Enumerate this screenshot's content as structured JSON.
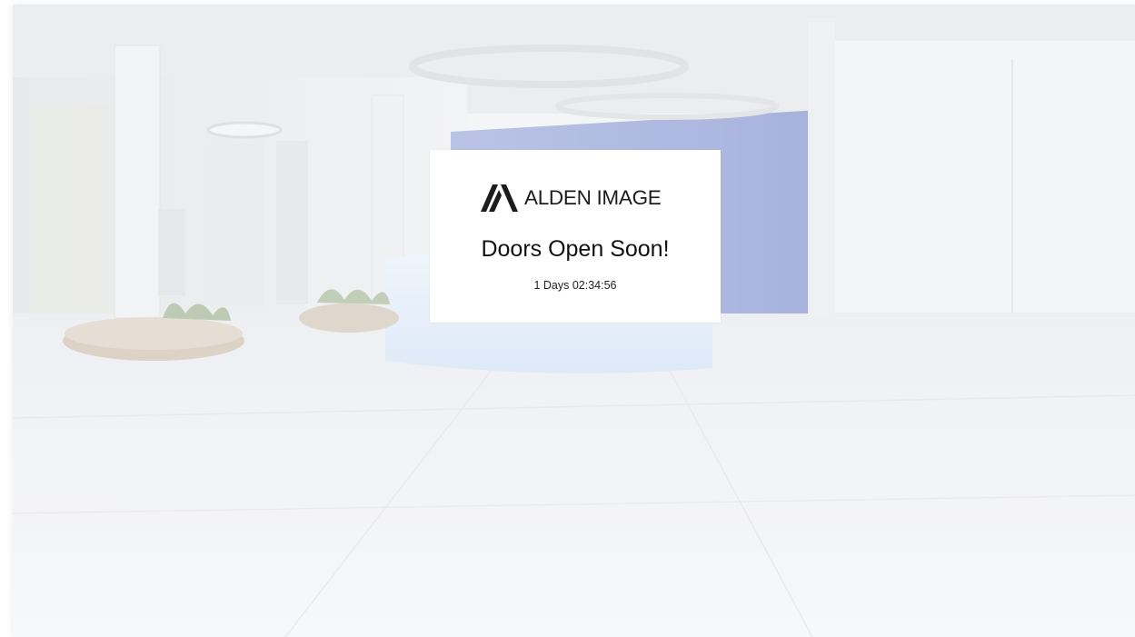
{
  "brand": {
    "logo_text": "ALDEN IMAGE",
    "logo_icon": "alden-image-logo-mark"
  },
  "notice": {
    "headline": "Doors Open Soon!",
    "countdown": "1 Days 02:34:56"
  },
  "background": {
    "scene": "lobby-interior",
    "accent_wall": "#8f9fd6"
  }
}
